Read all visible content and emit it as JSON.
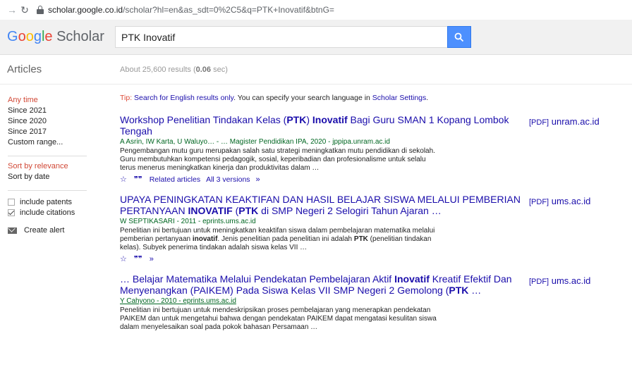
{
  "browser": {
    "url_domain": "scholar.google.co.id",
    "url_path": "/scholar?hl=en&as_sdt=0%2C5&q=PTK+Inovatif&btnG="
  },
  "header": {
    "logo_google": "Google",
    "logo_scholar": "Scholar",
    "search_value": "PTK Inovatif"
  },
  "subheader": {
    "label": "Articles",
    "count_prefix": "About 25,600 results (",
    "count_time": "0.06",
    "count_suffix": " sec)"
  },
  "sidebar": {
    "time_items": [
      "Any time",
      "Since 2021",
      "Since 2020",
      "Since 2017",
      "Custom range..."
    ],
    "sort_items": [
      "Sort by relevance",
      "Sort by date"
    ],
    "include_patents": "include patents",
    "include_citations": "include citations",
    "create_alert": "Create alert"
  },
  "tip": {
    "prefix": "Tip: ",
    "link1": "Search for English results only",
    "middle": ". You can specify your search language in ",
    "link2": "Scholar Settings",
    "end": "."
  },
  "results": [
    {
      "title_a": "Workshop Penelitian Tindakan Kelas (",
      "title_b": "PTK",
      "title_c": ") ",
      "title_d": "Inovatif",
      "title_e": " Bagi Guru SMAN 1 Kopang Lombok Tengah",
      "authors": "A Asrin, IW Karta, U Waluyo… - … Magister Pendidikan IPA, 2020 - jppipa.unram.ac.id",
      "snippet": "Pengembangan mutu guru merupakan salah satu strategi meningkatkan mutu pendidikan di sekolah. Guru membutuhkan kompetensi pedagogik, sosial, keperibadian dan profesionalisme untuk selalu terus menerus meningkatkan kinerja dan produktivitas dalam …",
      "related": "Related articles",
      "versions": "All 3 versions",
      "pdf_tag": "[PDF]",
      "pdf_source": "unram.ac.id"
    },
    {
      "title_a": "UPAYA PENINGKATAN KEAKTIFAN DAN HASIL BELAJAR SISWA MELALUI PEMBERIAN PERTANYAAN ",
      "title_b": "INOVATIF",
      "title_c": " (",
      "title_d": "PTK",
      "title_e": " di SMP Negeri 2 Selogiri Tahun Ajaran …",
      "authors": "W SEPTIKASARI - 2011 - eprints.ums.ac.id",
      "snippet_a": "Penelitian ini bertujuan untuk meningkatkan keaktifan siswa dalam pembelajaran matematika melalui pemberian pertanyaan ",
      "snippet_b": "inovatif",
      "snippet_c": ". Jenis penelitian pada penelitian ini adalah ",
      "snippet_d": "PTK",
      "snippet_e": " (penelitian tindakan kelas). Subyek penerima tindakan adalah siswa kelas VII …",
      "pdf_tag": "[PDF]",
      "pdf_source": "ums.ac.id"
    },
    {
      "title_a": "… Belajar Matematika Melalui Pendekatan Pembelajaran Aktif ",
      "title_b": "Inovatif",
      "title_c": " Kreatif Efektif Dan Menyenangkan (PAIKEM) Pada Siswa Kelas VII SMP Negeri 2 Gemolong (",
      "title_d": "PTK",
      "title_e": " …",
      "authors": "Y Cahyono - 2010 - eprints.ums.ac.id",
      "snippet": "Penelitian ini bertujuan untuk mendeskripsikan proses pembelajaran yang menerapkan pendekatan PAIKEM dan untuk mengetahui bahwa dengan pendekatan PAIKEM dapat mengatasi kesulitan siswa dalam menyelesaikan soal pada pokok bahasan Persamaan …",
      "pdf_tag": "[PDF]",
      "pdf_source": "ums.ac.id"
    }
  ],
  "colors": {
    "link": "#1a0dab",
    "author": "#006621",
    "active": "#d14836",
    "search_button": "#4d90fe"
  }
}
